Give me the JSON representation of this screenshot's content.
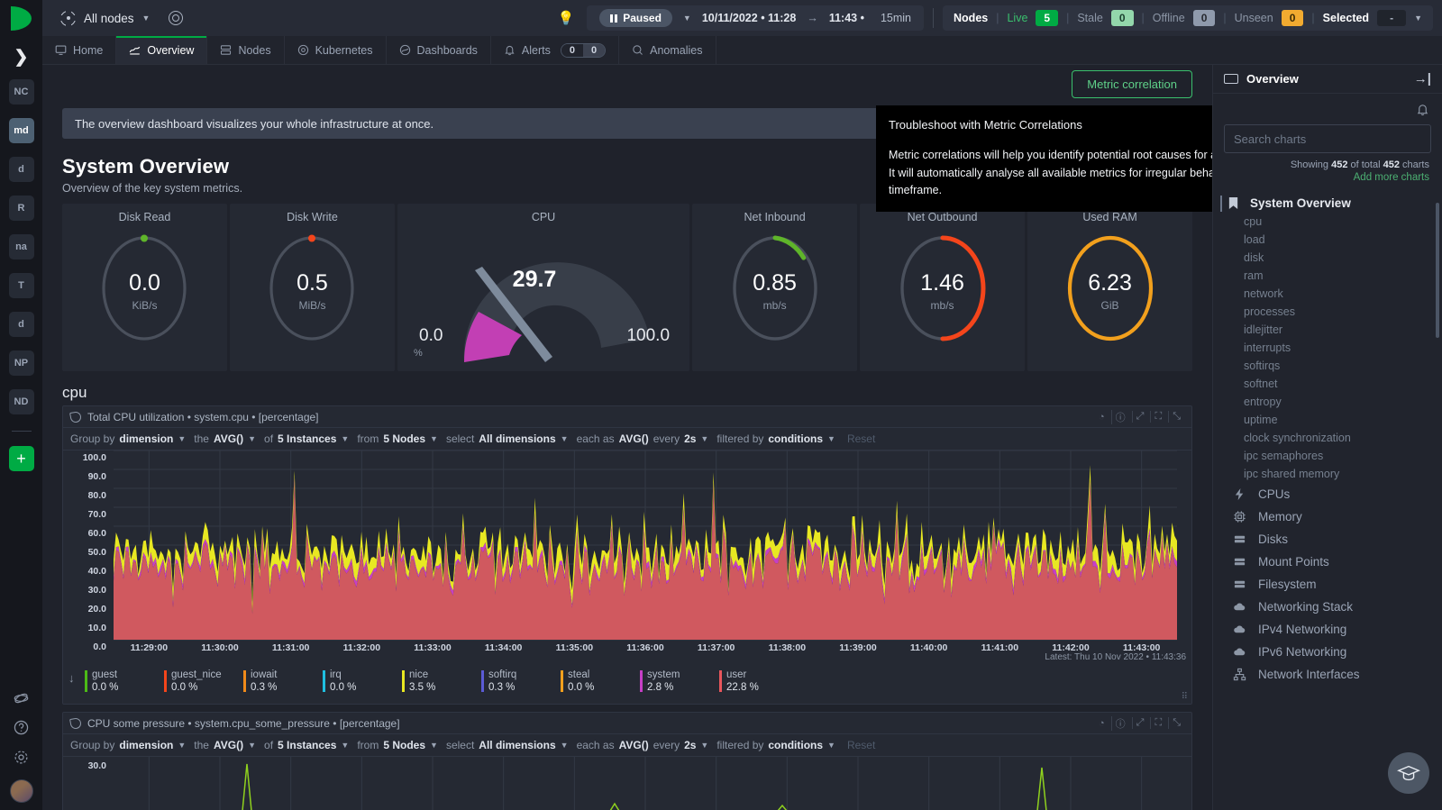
{
  "topbar": {
    "node_selector": "All nodes",
    "time": {
      "state": "Paused",
      "start": "10/11/2022 • 11:28",
      "arrow": "→",
      "end": "11:43 •",
      "duration": "15min"
    },
    "nodes": {
      "label": "Nodes",
      "live_label": "Live",
      "live_value": "5",
      "stale_label": "Stale",
      "stale_value": "0",
      "offline_label": "Offline",
      "offline_value": "0",
      "unseen_label": "Unseen",
      "unseen_value": "0",
      "selected_label": "Selected",
      "selected_value": "-"
    }
  },
  "tabs": [
    {
      "label": "Home",
      "icon": "monitor-icon"
    },
    {
      "label": "Overview",
      "icon": "overview-icon"
    },
    {
      "label": "Nodes",
      "icon": "nodes-icon"
    },
    {
      "label": "Kubernetes",
      "icon": "kubernetes-icon"
    },
    {
      "label": "Dashboards",
      "icon": "dashboards-icon"
    },
    {
      "label": "Alerts",
      "icon": "bell-icon",
      "badge_critical": "0",
      "badge_warning": "0"
    },
    {
      "label": "Anomalies",
      "icon": "anomalies-icon"
    }
  ],
  "rail": {
    "spaces": [
      "NC",
      "md",
      "d",
      "R",
      "na",
      "T",
      "d",
      "NP",
      "ND"
    ],
    "add_label": "+"
  },
  "main": {
    "metric_correlation_button": "Metric correlation",
    "notice": "The overview dashboard visualizes your whole infrastructure at once.",
    "section_title": "System Overview",
    "section_subtitle": "Overview of the key system metrics."
  },
  "tooltip": {
    "title": "Troubleshoot with Metric Correlations",
    "line1": "Metric correlations will help you identify potential root causes for an observed issue.",
    "line2": "It will automatically analyse all available metrics for irregular behavior for the same timeframe."
  },
  "gauges": [
    {
      "title": "Disk Read",
      "value": "0.0",
      "unit": "KiB/s",
      "color": "#5fb52a",
      "fill": 0.012,
      "dot": true
    },
    {
      "title": "Disk Write",
      "value": "0.5",
      "unit": "MiB/s",
      "color": "#f4451b",
      "fill": 0.012,
      "dot": true
    },
    {
      "title": "CPU",
      "value": "29.7",
      "unit": "%",
      "color": "#c23fb4",
      "min": "0.0",
      "max": "100.0"
    },
    {
      "title": "Net Inbound",
      "value": "0.85",
      "unit": "mb/s",
      "color": "#5fb52a",
      "fill": 0.11
    },
    {
      "title": "Net Outbound",
      "value": "1.46",
      "unit": "mb/s",
      "color": "#f4451b",
      "fill": 0.48
    },
    {
      "title": "Used RAM",
      "value": "6.23",
      "unit": "GiB",
      "color": "#f2a01d",
      "fill": 1.0
    }
  ],
  "charts": [
    {
      "section": "cpu",
      "header": "Total CPU utilization • system.cpu • [percentage]",
      "controls": {
        "group_by_label": "Group by",
        "group_by_value": "dimension",
        "the_label": "the",
        "the_value": "AVG()",
        "of_label": "of",
        "of_value": "5 Instances",
        "from_label": "from",
        "from_value": "5 Nodes",
        "select_label": "select",
        "select_value": "All dimensions",
        "each_label": "each as",
        "each_value": "AVG()",
        "every_label": "every",
        "every_value": "2s",
        "filtered_label": "filtered by",
        "filtered_value": "conditions",
        "reset_label": "Reset"
      },
      "latest": "Latest: Thu 10 Nov 2022 • 11:43:36",
      "legend": [
        {
          "name": "guest",
          "value": "0.0 %",
          "color": "#4cbb17"
        },
        {
          "name": "guest_nice",
          "value": "0.0 %",
          "color": "#f4451b"
        },
        {
          "name": "iowait",
          "value": "0.3 %",
          "color": "#f08a1a"
        },
        {
          "name": "irq",
          "value": "0.0 %",
          "color": "#1fbfe0"
        },
        {
          "name": "nice",
          "value": "3.5 %",
          "color": "#e8e822"
        },
        {
          "name": "softirq",
          "value": "0.3 %",
          "color": "#5b5bd6"
        },
        {
          "name": "steal",
          "value": "0.0 %",
          "color": "#f2a01d"
        },
        {
          "name": "system",
          "value": "2.8 %",
          "color": "#c63fc6"
        },
        {
          "name": "user",
          "value": "22.8 %",
          "color": "#e8565c"
        }
      ]
    },
    {
      "header": "CPU some pressure • system.cpu_some_pressure • [percentage]",
      "controls": {
        "group_by_label": "Group by",
        "group_by_value": "dimension",
        "the_label": "the",
        "the_value": "AVG()",
        "of_label": "of",
        "of_value": "5 Instances",
        "from_label": "from",
        "from_value": "5 Nodes",
        "select_label": "select",
        "select_value": "All dimensions",
        "each_label": "each as",
        "each_value": "AVG()",
        "every_label": "every",
        "every_value": "2s",
        "filtered_label": "filtered by",
        "filtered_value": "conditions",
        "reset_label": "Reset"
      }
    }
  ],
  "chart_data": {
    "type": "area",
    "title": "Total CPU utilization • system.cpu • [percentage]",
    "ylabel": "percentage",
    "xlabel": "",
    "ylim": [
      0,
      100
    ],
    "yticks": [
      "0.0",
      "10.0",
      "20.0",
      "30.0",
      "40.0",
      "50.0",
      "60.0",
      "70.0",
      "80.0",
      "90.0",
      "100.0"
    ],
    "xticks": [
      "11:29:00",
      "11:30:00",
      "11:31:00",
      "11:32:00",
      "11:33:00",
      "11:34:00",
      "11:35:00",
      "11:36:00",
      "11:37:00",
      "11:38:00",
      "11:39:00",
      "11:40:00",
      "11:41:00",
      "11:42:00",
      "11:43:00"
    ],
    "grid": true,
    "legend_position": "bottom",
    "series": [
      {
        "name": "guest",
        "color": "#4cbb17",
        "last_value": 0.0
      },
      {
        "name": "guest_nice",
        "color": "#f4451b",
        "last_value": 0.0
      },
      {
        "name": "iowait",
        "color": "#f08a1a",
        "last_value": 0.3
      },
      {
        "name": "irq",
        "color": "#1fbfe0",
        "last_value": 0.0
      },
      {
        "name": "nice",
        "color": "#e8e822",
        "last_value": 3.5
      },
      {
        "name": "softirq",
        "color": "#5b5bd6",
        "last_value": 0.3
      },
      {
        "name": "steal",
        "color": "#f2a01d",
        "last_value": 0.0
      },
      {
        "name": "system",
        "color": "#c63fc6",
        "last_value": 2.8
      },
      {
        "name": "user",
        "color": "#e8565c",
        "last_value": 22.8
      }
    ],
    "secondary_chart": {
      "type": "line",
      "title": "CPU some pressure • system.cpu_some_pressure • [percentage]",
      "yticks": [
        "30.0"
      ],
      "ylim": [
        0,
        30
      ]
    }
  },
  "sidebar": {
    "title": "Overview",
    "search_placeholder": "Search charts",
    "showing_prefix": "Showing",
    "showing_count": "452",
    "showing_mid": "of total",
    "total_count": "452",
    "showing_suffix": "charts",
    "add_more": "Add more charts",
    "group_title": "System Overview",
    "sub_items": [
      "cpu",
      "load",
      "disk",
      "ram",
      "network",
      "processes",
      "idlejitter",
      "interrupts",
      "softirqs",
      "softnet",
      "entropy",
      "uptime",
      "clock synchronization",
      "ipc semaphores",
      "ipc shared memory"
    ],
    "menu_items": [
      {
        "label": "CPUs",
        "icon": "bolt-icon"
      },
      {
        "label": "Memory",
        "icon": "chip-icon"
      },
      {
        "label": "Disks",
        "icon": "disk-icon"
      },
      {
        "label": "Mount Points",
        "icon": "disk-icon"
      },
      {
        "label": "Filesystem",
        "icon": "disk-icon"
      },
      {
        "label": "Networking Stack",
        "icon": "cloud-icon"
      },
      {
        "label": "IPv4 Networking",
        "icon": "cloud-icon"
      },
      {
        "label": "IPv6 Networking",
        "icon": "cloud-icon"
      },
      {
        "label": "Network Interfaces",
        "icon": "network-icon"
      }
    ]
  }
}
